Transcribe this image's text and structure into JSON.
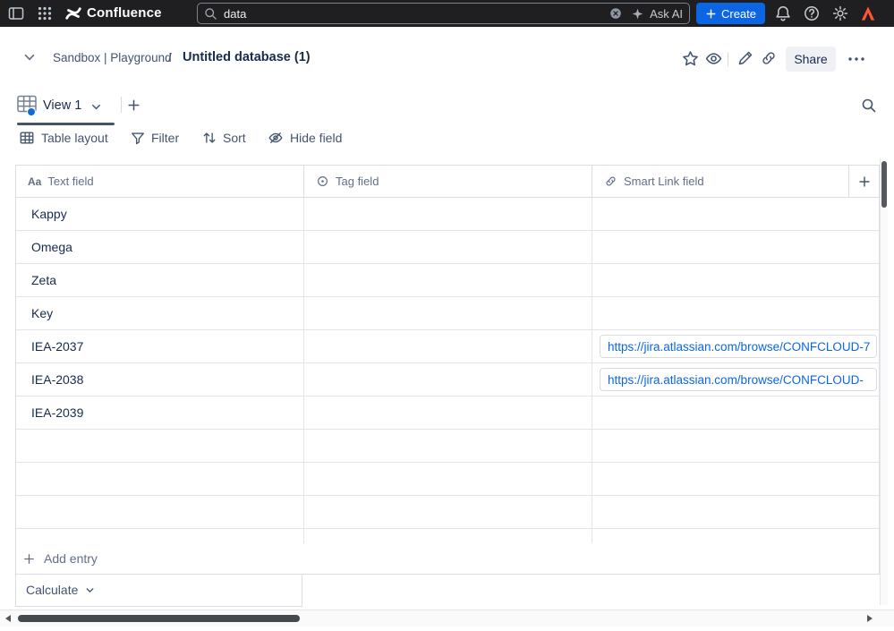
{
  "topbar": {
    "app_name": "Confluence",
    "search": {
      "value": "data",
      "ask_ai_label": "Ask AI"
    },
    "create_label": "Create"
  },
  "header": {
    "breadcrumb_space": "Sandbox | Playground",
    "breadcrumb_separator": "/",
    "page_title": "Untitled database (1)",
    "share_label": "Share"
  },
  "view_bar": {
    "active_view_label": "View 1"
  },
  "toolbar": {
    "table_layout_label": "Table layout",
    "filter_label": "Filter",
    "sort_label": "Sort",
    "hide_field_label": "Hide field"
  },
  "table": {
    "columns": [
      {
        "label": "Text field",
        "icon": "text-field-icon",
        "glyph": "Aa"
      },
      {
        "label": "Tag field",
        "icon": "tag-field-icon"
      },
      {
        "label": "Smart Link field",
        "icon": "smart-link-field-icon"
      }
    ],
    "rows": [
      {
        "text": "Kappy",
        "tag": "",
        "link": ""
      },
      {
        "text": "Omega",
        "tag": "",
        "link": ""
      },
      {
        "text": "Zeta",
        "tag": "",
        "link": ""
      },
      {
        "text": "Key",
        "tag": "",
        "link": ""
      },
      {
        "text": "IEA-2037",
        "tag": "",
        "link": "https://jira.atlassian.com/browse/CONFCLOUD-7"
      },
      {
        "text": "IEA-2038",
        "tag": "",
        "link": "https://jira.atlassian.com/browse/CONFCLOUD-"
      },
      {
        "text": "IEA-2039",
        "tag": "",
        "link": ""
      },
      {
        "text": "",
        "tag": "",
        "link": ""
      },
      {
        "text": "",
        "tag": "",
        "link": ""
      },
      {
        "text": "",
        "tag": "",
        "link": ""
      },
      {
        "text": "",
        "tag": "",
        "link": ""
      }
    ],
    "add_entry_label": "Add entry",
    "calculate_label": "Calculate"
  },
  "colors": {
    "topbar_bg": "#1F1F21",
    "accent_blue": "#0C66E4",
    "link_blue": "#0C66E4",
    "tab_indicator": "#44546F",
    "avatar_orange": "#FF5532",
    "border_gray": "#DADDE2"
  },
  "icons": {
    "sidebar_toggle": "panel-left",
    "app_switcher": "grid-dots",
    "logo": "confluence-blades",
    "search": "magnifier",
    "clear_search": "circle-x",
    "ask_ai": "sparkle",
    "create": "plus",
    "notifications": "bell",
    "help": "question-circle",
    "settings": "gear",
    "profile": "atlassian-a",
    "breadcrumb_expand": "chevron-down",
    "favorite": "star",
    "watch": "eye",
    "edit": "pencil",
    "copy_link": "link",
    "more": "ellipsis",
    "view": "database-grid",
    "add_view": "plus",
    "find_in_view": "magnifier",
    "table_layout": "table-grid",
    "filter": "funnel",
    "sort": "arrows-up-down",
    "hide_field": "eye-off",
    "add_field": "plus",
    "add_entry": "plus",
    "calculate_expand": "chevron-down"
  }
}
